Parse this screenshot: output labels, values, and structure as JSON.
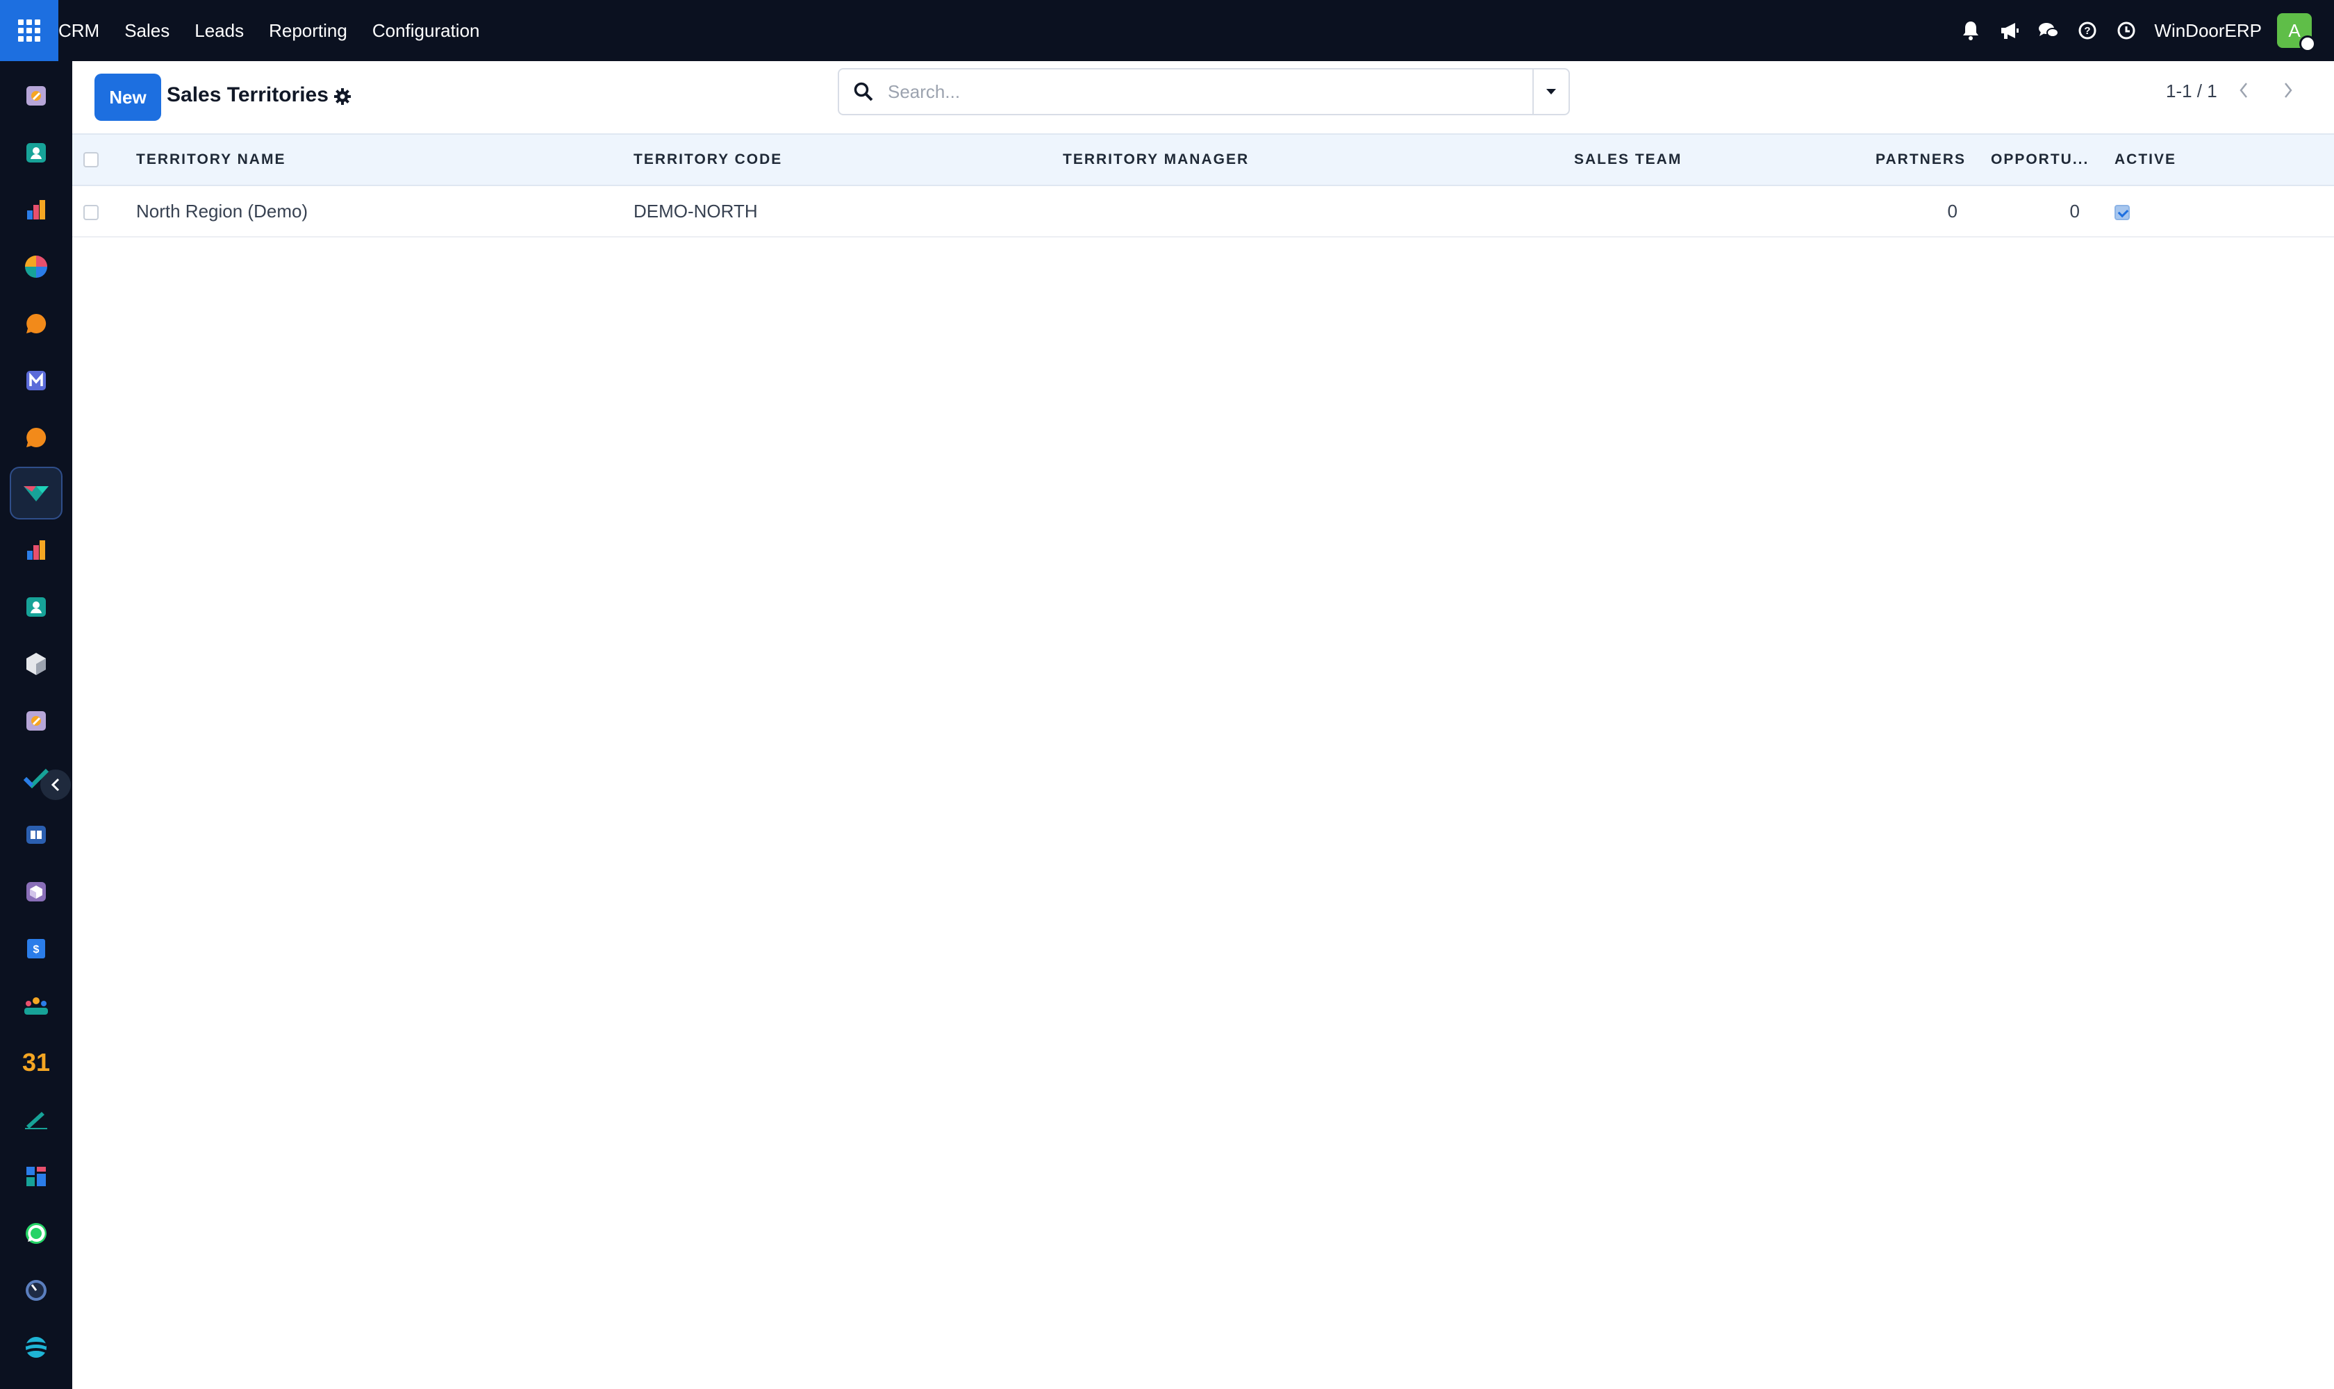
{
  "navbar": {
    "brand": "CRM",
    "menu": [
      {
        "label": "Sales"
      },
      {
        "label": "Leads"
      },
      {
        "label": "Reporting"
      },
      {
        "label": "Configuration"
      }
    ],
    "company": "WinDoorERP",
    "avatar_initial": "A",
    "icons": [
      "bell-icon",
      "megaphone-icon",
      "chat-icon",
      "help-icon",
      "clock-icon"
    ]
  },
  "sidebar": {
    "apps": [
      "discuss-icon",
      "contacts-icon",
      "dashboard-icon",
      "pie-chart-icon",
      "chat-bubble-icon",
      "mail-icon",
      "live-chat-icon",
      "crm-icon",
      "reporting-icon",
      "employees-icon",
      "inventory-icon",
      "documents-icon",
      "project-icon",
      "knowledge-icon",
      "product-box-icon",
      "invoicing-icon",
      "team-icon",
      "calendar-icon",
      "sign-icon",
      "apps-dashboard-icon",
      "whatsapp-icon",
      "timer-icon",
      "website-icon"
    ],
    "calendar_text": "31",
    "active_app": "crm-icon"
  },
  "control_panel": {
    "new_label": "New",
    "title": "Sales Territories",
    "search_placeholder": "Search...",
    "pager": "1-1 / 1"
  },
  "table": {
    "columns": [
      {
        "label": "TERRITORY NAME"
      },
      {
        "label": "TERRITORY CODE"
      },
      {
        "label": "TERRITORY MANAGER"
      },
      {
        "label": "SALES TEAM"
      },
      {
        "label": "PARTNERS"
      },
      {
        "label": "OPPORTU..."
      },
      {
        "label": "ACTIVE"
      }
    ],
    "rows": [
      {
        "name": "North Region (Demo)",
        "code": "DEMO-NORTH",
        "manager": "",
        "team": "",
        "partners": "0",
        "opportunities": "0",
        "active": true
      }
    ]
  },
  "colors": {
    "navbar_bg": "#0b1120",
    "primary": "#1d6fe0",
    "header_row_bg": "#eef5fd"
  }
}
